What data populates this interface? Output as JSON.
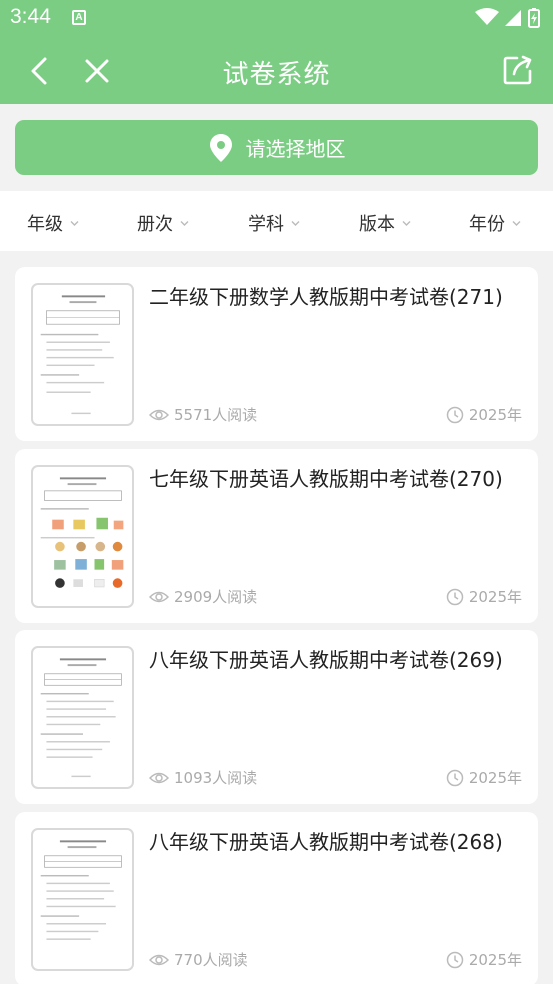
{
  "status": {
    "time": "3:44",
    "notif_letter": "A"
  },
  "header": {
    "title": "试卷系统"
  },
  "region": {
    "label": "请选择地区"
  },
  "filters": [
    "年级",
    "册次",
    "学科",
    "版本",
    "年份"
  ],
  "papers": [
    {
      "title": "二年级下册数学人教版期中考试卷(271)",
      "views": "5571人阅读",
      "year": "2025年"
    },
    {
      "title": "七年级下册英语人教版期中考试卷(270)",
      "views": "2909人阅读",
      "year": "2025年"
    },
    {
      "title": "八年级下册英语人教版期中考试卷(269)",
      "views": "1093人阅读",
      "year": "2025年"
    },
    {
      "title": "八年级下册英语人教版期中考试卷(268)",
      "views": "770人阅读",
      "year": "2025年"
    }
  ],
  "colors": {
    "accent": "#7ccd84",
    "background": "#f2f2f2"
  }
}
